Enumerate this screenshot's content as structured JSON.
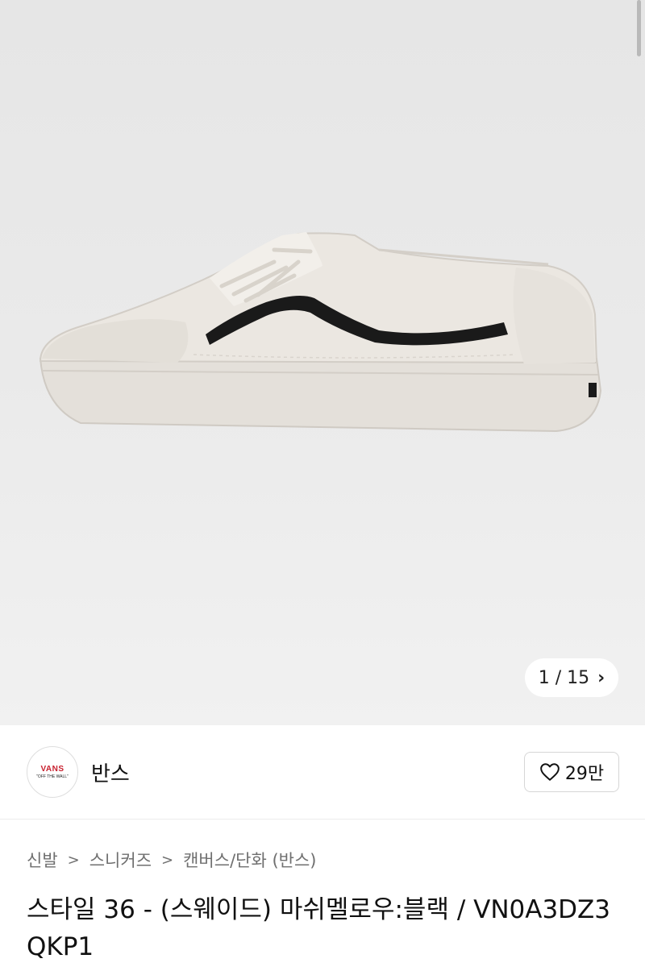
{
  "gallery": {
    "current": "1",
    "separator": " / ",
    "total": "15",
    "next_icon": "chevron-right-icon"
  },
  "brand": {
    "name": "반스",
    "logo_text": "VANS",
    "logo_tagline": "\"OFF THE WALL\""
  },
  "like": {
    "icon": "heart-outline-icon",
    "count": "29만"
  },
  "breadcrumb": [
    "신발",
    "스니커즈",
    "캔버스/단화 (반스)"
  ],
  "product": {
    "title": "스타일 36 - (스웨이드) 마쉬멜로우:블랙 / VN0A3DZ3QKP1"
  },
  "colors": {
    "logo_red": "#c8202e",
    "shoe_body": "#e9e5df",
    "stripe": "#1a1a1a"
  }
}
